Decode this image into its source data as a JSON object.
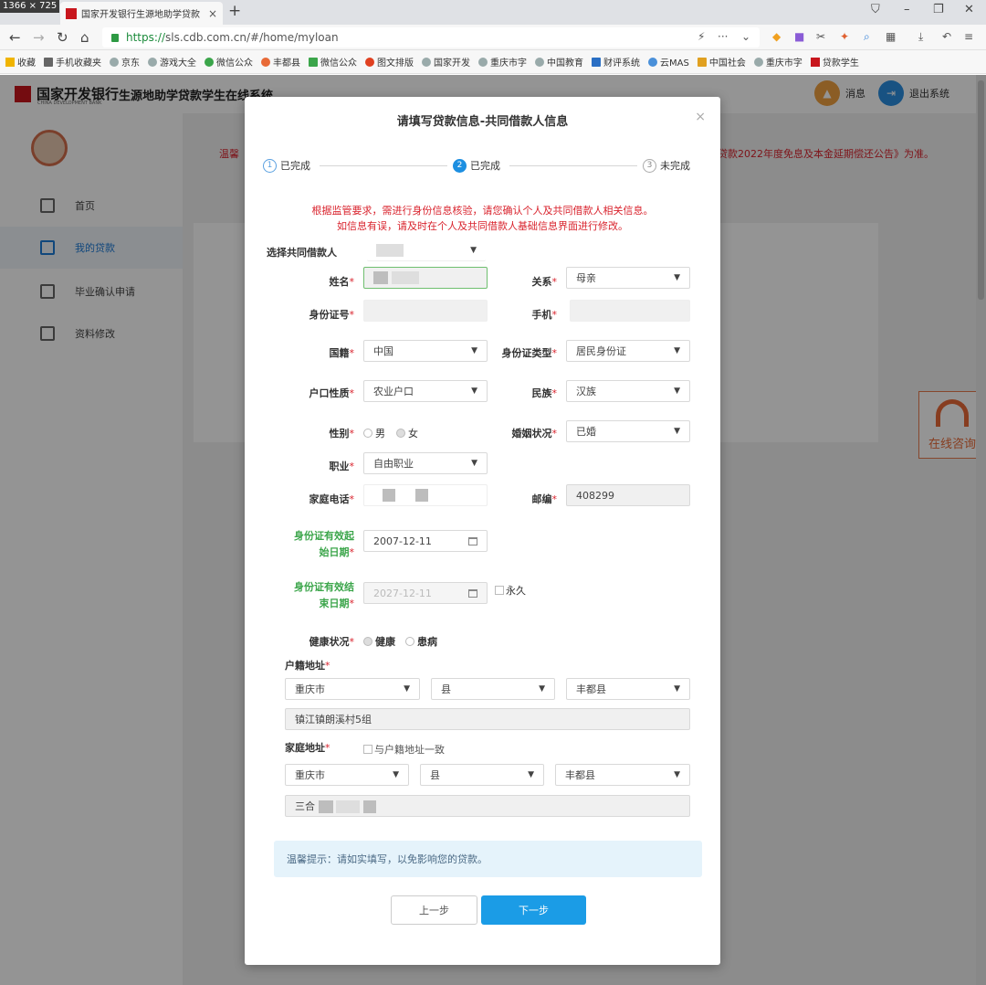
{
  "browser": {
    "dimension_badge": "1366 × 725",
    "tab_title": "国家开发银行生源地助学贷款",
    "url_prefix": "https://",
    "url_host": "sls.cdb.com.cn",
    "url_path": "/#/home/myloan",
    "bookmarks": [
      "收藏",
      "手机收藏夹",
      "京东",
      "游戏大全",
      "微信公众",
      "丰都县",
      "微信公众",
      "图文排版",
      "国家开发",
      "重庆市字",
      "中国教育",
      "财评系统",
      "云MAS",
      "中国社会",
      "重庆市字",
      "贷款学生"
    ]
  },
  "site": {
    "bank_name": "国家开发银行",
    "bank_en": "CHINA DEVELOPMENT BANK",
    "system_title": "生源地助学贷款学生在线系统",
    "header_actions": {
      "messages": "消息",
      "logout": "退出系统"
    },
    "sidebar": [
      {
        "label": "首页"
      },
      {
        "label": "我的贷款"
      },
      {
        "label": "毕业确认申请"
      },
      {
        "label": "资料修改"
      }
    ],
    "notice_left": "温馨",
    "notice_right": "贷款2022年度免息及本金延期偿还公告》为准。",
    "online_consult": "在线咨询"
  },
  "modal": {
    "title": "请填写贷款信息-共同借款人信息",
    "close": "×",
    "steps": [
      {
        "num": "1",
        "label": "已完成"
      },
      {
        "num": "2",
        "label": "已完成"
      },
      {
        "num": "3",
        "label": "未完成"
      }
    ],
    "warning_line1": "根据监管要求，需进行身份信息核验，请您确认个人及共同借款人相关信息。",
    "warning_line2": "如信息有误，请及时在个人及共同借款人基础信息界面进行修改。",
    "form": {
      "co_borrower_label": "选择共同借款人",
      "name_label": "姓名",
      "relation_label": "关系",
      "relation_value": "母亲",
      "idno_label": "身份证号",
      "phone_label": "手机",
      "nationality_label": "国籍",
      "nationality_value": "中国",
      "idtype_label": "身份证类型",
      "idtype_value": "居民身份证",
      "hukou_label": "户口性质",
      "hukou_value": "农业户口",
      "ethnic_label": "民族",
      "ethnic_value": "汉族",
      "gender_label": "性别",
      "gender_options": [
        "男",
        "女"
      ],
      "marital_label": "婚姻状况",
      "marital_value": "已婚",
      "job_label": "职业",
      "job_value": "自由职业",
      "homephone_label": "家庭电话",
      "postcode_label": "邮编",
      "postcode_value": "408299",
      "id_start_label_1": "身份证有效起",
      "id_start_label_2": "始日期",
      "id_start_value": "2007-12-11",
      "id_end_label_1": "身份证有效结",
      "id_end_label_2": "束日期",
      "id_end_value": "2027-12-11",
      "permanent_label": "永久",
      "health_label": "健康状况",
      "health_options": [
        "健康",
        "患病"
      ],
      "reg_addr_label": "户籍地址",
      "reg_city": "重庆市",
      "reg_county_type": "县",
      "reg_county": "丰都县",
      "reg_detail": "镇江镇朗溪村5组",
      "home_addr_label": "家庭地址",
      "same_addr_label": "与户籍地址一致",
      "home_city": "重庆市",
      "home_county_type": "县",
      "home_county": "丰都县",
      "home_detail_prefix": "三合"
    },
    "tip": "温馨提示：请如实填写，以免影响您的贷款。",
    "prev_button": "上一步",
    "next_button": "下一步"
  }
}
